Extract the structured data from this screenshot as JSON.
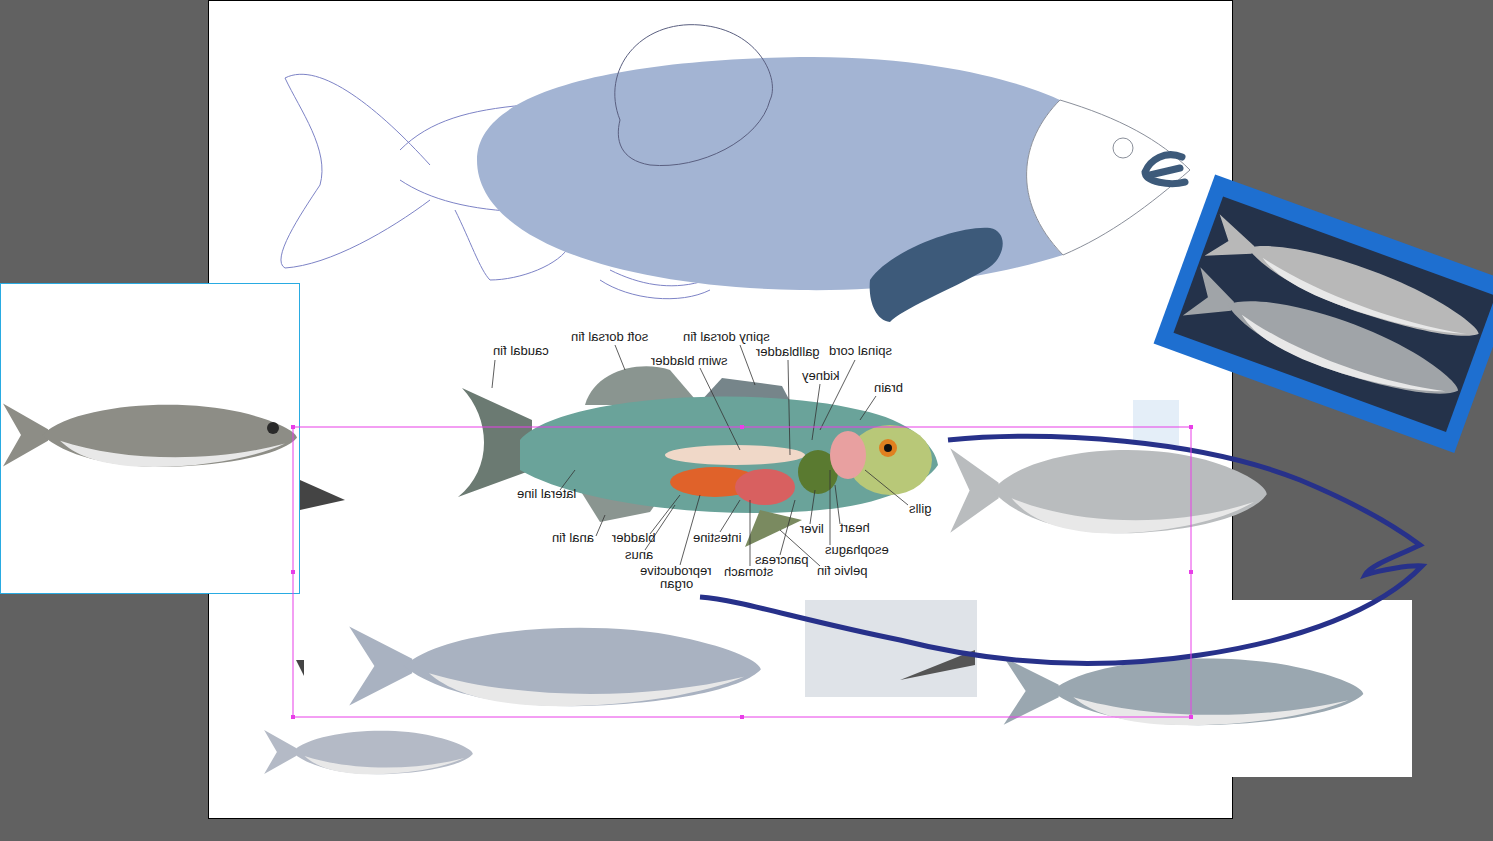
{
  "diagram": {
    "labels": [
      {
        "text": "caudal fin"
      },
      {
        "text": "soft dorsal fin"
      },
      {
        "text": "spiny dorsal fin"
      },
      {
        "text": "swim bladder"
      },
      {
        "text": "gallbladder"
      },
      {
        "text": "spinal cord"
      },
      {
        "text": "kidney"
      },
      {
        "text": "brain"
      },
      {
        "text": "lateral line"
      },
      {
        "text": "gills"
      },
      {
        "text": "heart"
      },
      {
        "text": "liver"
      },
      {
        "text": "intestine"
      },
      {
        "text": "anal fin"
      },
      {
        "text": "bladder"
      },
      {
        "text": "anus"
      },
      {
        "text": "esophagus"
      },
      {
        "text": "pancreas"
      },
      {
        "text": "pelvic fin"
      },
      {
        "text": "stomach"
      },
      {
        "text": "reproductive"
      },
      {
        "text": "organ"
      }
    ]
  }
}
